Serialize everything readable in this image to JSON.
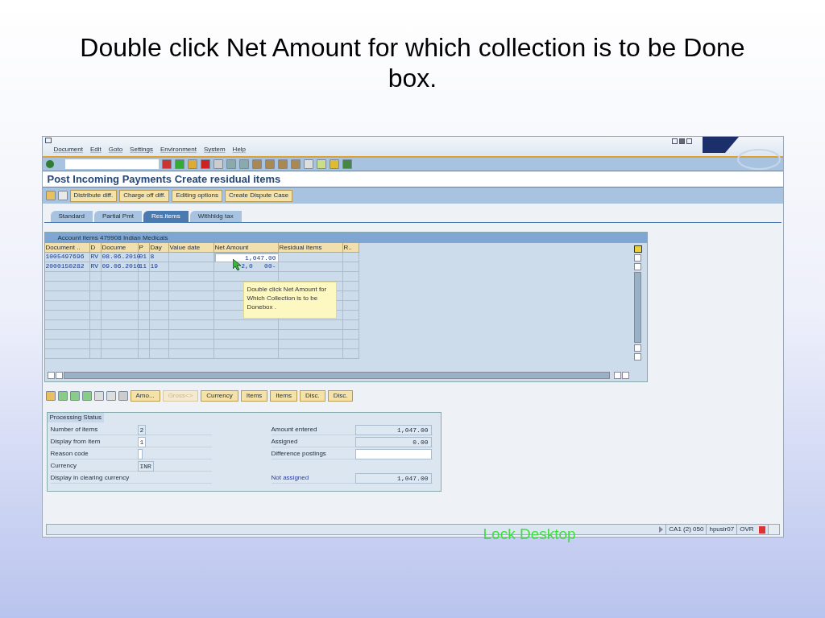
{
  "slide": {
    "title": "Double click Net Amount for which collection is to be Done box."
  },
  "window": {
    "menu": [
      "Document",
      "Edit",
      "Goto",
      "Settings",
      "Environment",
      "System",
      "Help"
    ],
    "title": "Post Incoming Payments Create residual items",
    "app_buttons": [
      "Distribute diff.",
      "Charge off diff.",
      "Editing options",
      "Create Dispute Case"
    ],
    "tabs": [
      {
        "label": "Standard",
        "selected": false
      },
      {
        "label": "Partial Pmt",
        "selected": false
      },
      {
        "label": "Res.items",
        "selected": true
      },
      {
        "label": "Withhldg tax",
        "selected": false
      }
    ],
    "table": {
      "title": "Account items 479908 Indian Medicals",
      "columns": [
        "Document ..",
        "D",
        "Docume",
        "P",
        "Day",
        "Value date",
        "Net Amount",
        "Residual Items",
        "R.."
      ],
      "rows": [
        {
          "cells": [
            "1005497696",
            "RV",
            "08.06.2010",
            "01",
            "8",
            "",
            "1,047.00",
            "",
            ""
          ],
          "selected": true
        },
        {
          "cells": [
            "2000150282",
            "RV",
            "09.06.2010",
            "11",
            "19",
            "",
            "2,0   00-",
            "",
            ""
          ],
          "selected": false
        }
      ]
    },
    "tooltip": "Double click Net Amount for Which Collection is to be Donebox .",
    "alv_buttons": [
      {
        "label": "Amo...",
        "disabled": false
      },
      {
        "label": "Gross<>",
        "disabled": true
      },
      {
        "label": "Currency",
        "disabled": false
      },
      {
        "label": "Items",
        "disabled": false
      },
      {
        "label": "Items",
        "disabled": false
      },
      {
        "label": "Disc.",
        "disabled": false
      },
      {
        "label": "Disc.",
        "disabled": false
      }
    ],
    "processing_status": {
      "title": "Processing Status",
      "left": [
        {
          "label": "Number of items",
          "value": "2",
          "kind": "display"
        },
        {
          "label": "Display from item",
          "value": "1",
          "kind": "input"
        },
        {
          "label": "Reason code",
          "kind": "input"
        },
        {
          "label": "Currency",
          "value": "INR",
          "kind": "display"
        },
        {
          "label": "Display in clearing currency",
          "kind": "label"
        }
      ],
      "right": [
        {
          "label": "Amount entered",
          "value": "1,047.00",
          "kind": "display"
        },
        {
          "label": "Assigned",
          "value": "0.00",
          "kind": "display"
        },
        {
          "label": "Difference postings",
          "kind": "input"
        },
        {
          "label": "Not assigned",
          "value": "1,047.00",
          "kind": "total"
        }
      ]
    },
    "status_bar": {
      "overlay_text": "Lock Desktop",
      "items": [
        "CA1 (2) 050",
        "hpusir07",
        "OVR"
      ]
    }
  }
}
